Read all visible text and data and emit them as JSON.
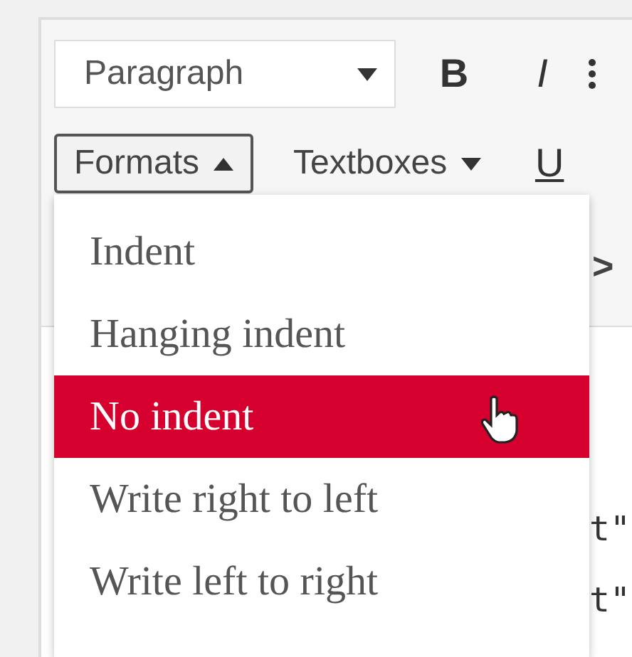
{
  "toolbar": {
    "block_select": {
      "value": "Paragraph"
    },
    "buttons": [
      {
        "label": "B",
        "kind": "bold"
      },
      {
        "label": "I",
        "kind": "italic"
      }
    ],
    "formats_button": {
      "label": "Formats",
      "expanded": true
    },
    "textboxes_button": {
      "label": "Textboxes",
      "expanded": false
    },
    "underline_button": {
      "label": "U"
    },
    "more_button": {
      "label": ">"
    }
  },
  "formats_menu": [
    {
      "label": "Indent",
      "selected": false
    },
    {
      "label": "Hanging indent",
      "selected": false
    },
    {
      "label": "No indent",
      "selected": true
    },
    {
      "label": "Write right to left",
      "selected": false
    },
    {
      "label": "Write left to right",
      "selected": false
    }
  ],
  "code_lines": [
    "t\"",
    "t\""
  ]
}
